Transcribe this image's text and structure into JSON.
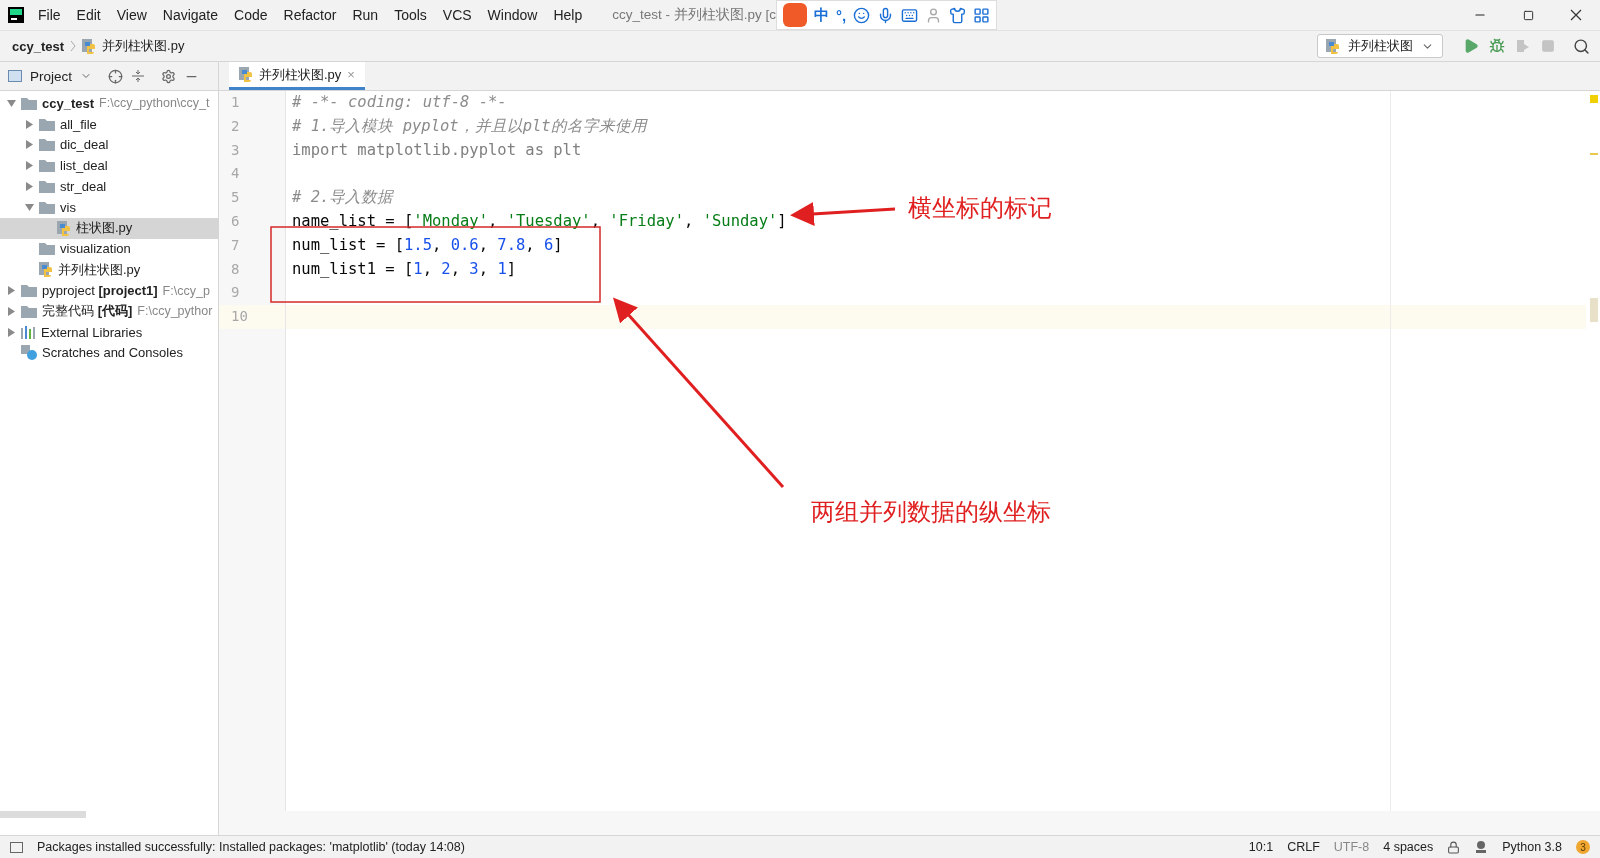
{
  "menu_bar": {
    "items": [
      "File",
      "Edit",
      "View",
      "Navigate",
      "Code",
      "Refactor",
      "Run",
      "Tools",
      "VCS",
      "Window",
      "Help"
    ],
    "title": "ccy_test - 并列柱状图.py [c",
    "ime": {
      "label": "中",
      "punct": "°,"
    }
  },
  "nav_bar": {
    "breadcrumbs": [
      "ccy_test",
      "并列柱状图.py"
    ],
    "run_config": "并列柱状图"
  },
  "project_panel": {
    "title": "Project",
    "tree": [
      {
        "label": "ccy_test",
        "path": "F:\\ccy_python\\ccy_t",
        "kind": "folder",
        "bold": true,
        "expanded": true,
        "selected": false,
        "children": [
          {
            "label": "all_file",
            "kind": "folder",
            "expanded": false,
            "selected": false
          },
          {
            "label": "dic_deal",
            "kind": "folder",
            "expanded": false,
            "selected": false
          },
          {
            "label": "list_deal",
            "kind": "folder",
            "expanded": false,
            "selected": false
          },
          {
            "label": "str_deal",
            "kind": "folder",
            "expanded": false,
            "selected": false
          },
          {
            "label": "vis",
            "kind": "folder",
            "expanded": true,
            "selected": false,
            "children": [
              {
                "label": "柱状图.py",
                "kind": "file",
                "selected": true
              }
            ]
          },
          {
            "label": "visualization",
            "kind": "folder",
            "selected": false
          },
          {
            "label": "并列柱状图.py",
            "kind": "file",
            "selected": false
          }
        ]
      },
      {
        "label": "pyproject **[project1]**",
        "path": "F:\\ccy_p",
        "kind": "folder",
        "expanded": false,
        "selected": false
      },
      {
        "label": "完整代码 **[代码]**",
        "path": "F:\\ccy_pythor",
        "kind": "folder",
        "expanded": false,
        "selected": false
      },
      {
        "label": "External Libraries",
        "kind": "libraries",
        "expanded": false,
        "selected": false
      },
      {
        "label": "Scratches and Consoles",
        "kind": "scratches",
        "selected": false
      }
    ]
  },
  "tabs": [
    {
      "label": "并列柱状图.py",
      "selected": true,
      "close": "×"
    }
  ],
  "editor": {
    "lines": [
      {
        "number": "1",
        "current": false,
        "tokens": [
          {
            "kind": "comment",
            "text": "# -*- coding: utf-8 -*-"
          }
        ]
      },
      {
        "number": "2",
        "current": false,
        "tokens": [
          {
            "kind": "comment",
            "text": "# 1.导入模块 pyplot，并且以plt的名字来使用"
          }
        ]
      },
      {
        "number": "3",
        "current": false,
        "tokens": [
          {
            "kind": "unused",
            "text": "import matplotlib.pyplot as plt"
          }
        ]
      },
      {
        "number": "4",
        "current": false
      },
      {
        "number": "5",
        "current": false,
        "tokens": [
          {
            "kind": "comment",
            "text": "# 2.导入数据"
          }
        ]
      },
      {
        "number": "6",
        "current": false,
        "tokens": [
          {
            "kind": "plain",
            "text": "name_list = ["
          },
          {
            "kind": "string",
            "text": "'Monday'"
          },
          {
            "kind": "plain",
            "text": ", "
          },
          {
            "kind": "string",
            "text": "'Tuesday'"
          },
          {
            "kind": "plain",
            "text": ", "
          },
          {
            "kind": "string",
            "text": "'Friday'"
          },
          {
            "kind": "plain",
            "text": ", "
          },
          {
            "kind": "string",
            "text": "'Sunday'"
          },
          {
            "kind": "plain",
            "text": "]"
          }
        ]
      },
      {
        "number": "7",
        "current": false,
        "tokens": [
          {
            "kind": "plain",
            "text": "num_list = ["
          },
          {
            "kind": "number",
            "text": "1.5"
          },
          {
            "kind": "plain",
            "text": ", "
          },
          {
            "kind": "number",
            "text": "0.6"
          },
          {
            "kind": "plain",
            "text": ", "
          },
          {
            "kind": "number",
            "text": "7.8"
          },
          {
            "kind": "plain",
            "text": ", "
          },
          {
            "kind": "number",
            "text": "6"
          },
          {
            "kind": "plain",
            "text": "]"
          }
        ]
      },
      {
        "number": "8",
        "current": false,
        "tokens": [
          {
            "kind": "plain",
            "text": "num_list1 = ["
          },
          {
            "kind": "number",
            "text": "1"
          },
          {
            "kind": "plain",
            "text": ", "
          },
          {
            "kind": "number",
            "text": "2"
          },
          {
            "kind": "plain",
            "text": ", "
          },
          {
            "kind": "number",
            "text": "3"
          },
          {
            "kind": "plain",
            "text": ", "
          },
          {
            "kind": "number",
            "text": "1"
          },
          {
            "kind": "plain",
            "text": "]"
          }
        ]
      },
      {
        "number": "9",
        "current": false
      },
      {
        "number": "10",
        "current": true
      }
    ]
  },
  "annotations": [
    {
      "text": "横坐标的标记"
    },
    {
      "text": "两组并列数据的纵坐标"
    }
  ],
  "status_bar": {
    "message": "Packages installed successfully: Installed packages: 'matplotlib' (today 14:08)",
    "position": "10:1",
    "line_separator": "CRLF",
    "encoding": "UTF-8",
    "indent": "4 spaces",
    "interpreter": "Python 3.8",
    "notifications": "3"
  }
}
